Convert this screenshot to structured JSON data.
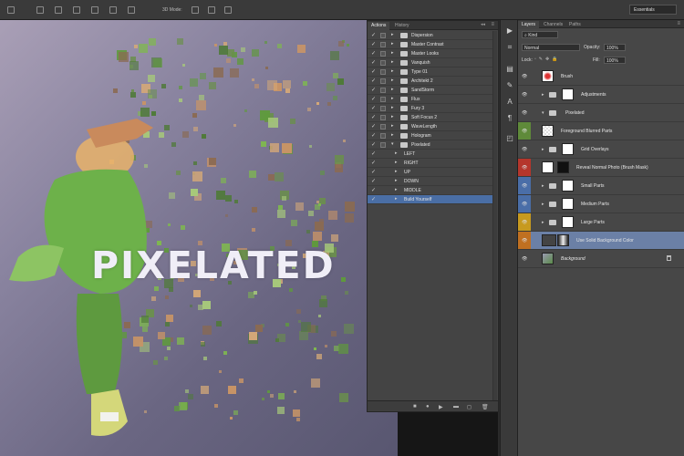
{
  "toolbar": {
    "mode_label": "3D Mode:",
    "workspace": "Essentials"
  },
  "canvas": {
    "title_text": "PIXELATED"
  },
  "actions_panel": {
    "tabs": [
      "Actions",
      "History"
    ],
    "items": [
      {
        "label": "Dispersion",
        "folder": true,
        "expanded": false,
        "level": 0
      },
      {
        "label": "Master Contrast",
        "folder": true,
        "expanded": false,
        "level": 0
      },
      {
        "label": "Master Looks",
        "folder": true,
        "expanded": false,
        "level": 0
      },
      {
        "label": "Vanquish",
        "folder": true,
        "expanded": false,
        "level": 0
      },
      {
        "label": "Type 01",
        "folder": true,
        "expanded": false,
        "level": 0
      },
      {
        "label": "Architekt 2",
        "folder": true,
        "expanded": false,
        "level": 0
      },
      {
        "label": "SandStorm",
        "folder": true,
        "expanded": false,
        "level": 0
      },
      {
        "label": "Flux",
        "folder": true,
        "expanded": false,
        "level": 0
      },
      {
        "label": "Fury 3",
        "folder": true,
        "expanded": false,
        "level": 0
      },
      {
        "label": "Soft Focus 2",
        "folder": true,
        "expanded": false,
        "level": 0
      },
      {
        "label": "WaveLength",
        "folder": true,
        "expanded": false,
        "level": 0
      },
      {
        "label": "Hologram",
        "folder": true,
        "expanded": false,
        "level": 0
      },
      {
        "label": "Pixelated",
        "folder": true,
        "expanded": true,
        "level": 0
      },
      {
        "label": "LEFT",
        "folder": false,
        "expanded": false,
        "level": 1
      },
      {
        "label": "RIGHT",
        "folder": false,
        "expanded": false,
        "level": 1
      },
      {
        "label": "UP",
        "folder": false,
        "expanded": false,
        "level": 1
      },
      {
        "label": "DOWN",
        "folder": false,
        "expanded": false,
        "level": 1
      },
      {
        "label": "MIDDLE",
        "folder": false,
        "expanded": false,
        "level": 1
      },
      {
        "label": "Build Yourself",
        "folder": false,
        "expanded": false,
        "level": 1,
        "selected": true
      }
    ]
  },
  "layers_panel": {
    "tabs": [
      "Layers",
      "Channels",
      "Paths"
    ],
    "filter": "Kind",
    "blend_mode": "Normal",
    "opacity_label": "Opacity:",
    "opacity": "100%",
    "lock_label": "Lock:",
    "fill_label": "Fill:",
    "fill": "100%",
    "layers": [
      {
        "name": "Brush",
        "color": "",
        "group": false,
        "thumb": "red"
      },
      {
        "name": "Adjustments",
        "color": "",
        "group": true,
        "thumb": "white"
      },
      {
        "name": "Pixelated",
        "color": "",
        "group": true,
        "expanded": true,
        "thumb": "none"
      },
      {
        "name": "Foreground Blurred Parts",
        "color": "#5f8a3a",
        "group": false,
        "thumb": "check"
      },
      {
        "name": "Grid Overlays",
        "color": "",
        "group": true,
        "thumb": "white"
      },
      {
        "name": "Reveal Normal Photo (Brush Mask)",
        "color": "#b5362c",
        "group": false,
        "thumb": "mask"
      },
      {
        "name": "Small Parts",
        "color": "#4a6ea8",
        "group": true,
        "thumb": "white"
      },
      {
        "name": "Medium Parts",
        "color": "#4a6ea8",
        "group": true,
        "thumb": "white"
      },
      {
        "name": "Large Parts",
        "color": "#c79a1f",
        "group": true,
        "thumb": "white"
      },
      {
        "name": "Use Solid Background Color",
        "color": "#c07021",
        "group": false,
        "thumb": "dark",
        "selected": true
      },
      {
        "name": "Background",
        "color": "",
        "group": false,
        "thumb": "photo",
        "italic": true,
        "locked": true
      }
    ]
  },
  "colors": {
    "selection": "#4a6ea5",
    "layer_selection": "#6b80a6",
    "panel": "#474747"
  }
}
